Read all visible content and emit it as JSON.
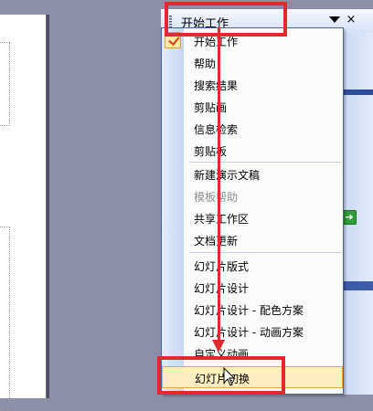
{
  "task_pane": {
    "title": "开始工作",
    "close_glyph": "×",
    "icons": [
      "grip-icon",
      "chevron-down-icon",
      "close-icon",
      "green-arrow-icon"
    ]
  },
  "menu": {
    "items": [
      {
        "label": "开始工作",
        "checked": true,
        "disabled": false
      },
      {
        "label": "帮助",
        "checked": false,
        "disabled": false
      },
      {
        "label": "搜索结果",
        "checked": false,
        "disabled": false
      },
      {
        "label": "剪贴画",
        "checked": false,
        "disabled": false
      },
      {
        "label": "信息检索",
        "checked": false,
        "disabled": false
      },
      {
        "label": "剪贴板",
        "checked": false,
        "disabled": false
      },
      {
        "label": "新建演示文稿",
        "checked": false,
        "disabled": false
      },
      {
        "label": "模板帮助",
        "checked": false,
        "disabled": true
      },
      {
        "label": "共享工作区",
        "checked": false,
        "disabled": false
      },
      {
        "label": "文档更新",
        "checked": false,
        "disabled": false
      },
      {
        "label": "幻灯片版式",
        "checked": false,
        "disabled": false
      },
      {
        "label": "幻灯片设计",
        "checked": false,
        "disabled": false
      },
      {
        "label": "幻灯片设计 - 配色方案",
        "checked": false,
        "disabled": false
      },
      {
        "label": "幻灯片设计 - 动画方案",
        "checked": false,
        "disabled": false
      },
      {
        "label": "自定义动画",
        "checked": false,
        "disabled": false
      },
      {
        "label": "幻灯片切换",
        "checked": false,
        "disabled": false,
        "hovered": true
      }
    ]
  },
  "colors": {
    "highlight_red": "#e02a2e",
    "hover_bg": "#ffeec2",
    "pane_blue": "#c6d6f2"
  }
}
